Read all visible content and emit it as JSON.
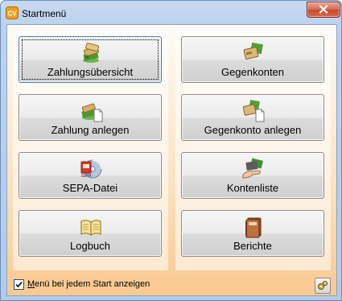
{
  "window": {
    "title": "Startmenü",
    "app_icon_text": "CV"
  },
  "left_column": [
    {
      "label": "Zahlungsübersicht",
      "icon": "money-stack-icon",
      "focused": true
    },
    {
      "label": "Zahlung anlegen",
      "icon": "money-add-document-icon",
      "focused": false
    },
    {
      "label": "SEPA-Datei",
      "icon": "sepa-disc-icon",
      "focused": false
    },
    {
      "label": "Logbuch",
      "icon": "open-book-icon",
      "focused": false
    }
  ],
  "right_column": [
    {
      "label": "Gegenkonten",
      "icon": "account-card-icon",
      "focused": false
    },
    {
      "label": "Gegenkonto anlegen",
      "icon": "account-add-document-icon",
      "focused": false
    },
    {
      "label": "Kontenliste",
      "icon": "hand-card-icon",
      "focused": false
    },
    {
      "label": "Berichte",
      "icon": "closed-book-icon",
      "focused": false
    }
  ],
  "footer": {
    "checkbox_checked": true,
    "checkbox_label_first": "M",
    "checkbox_label_rest": "enü bei jedem Start anzeigen",
    "settings_icon": "gear-icon"
  }
}
